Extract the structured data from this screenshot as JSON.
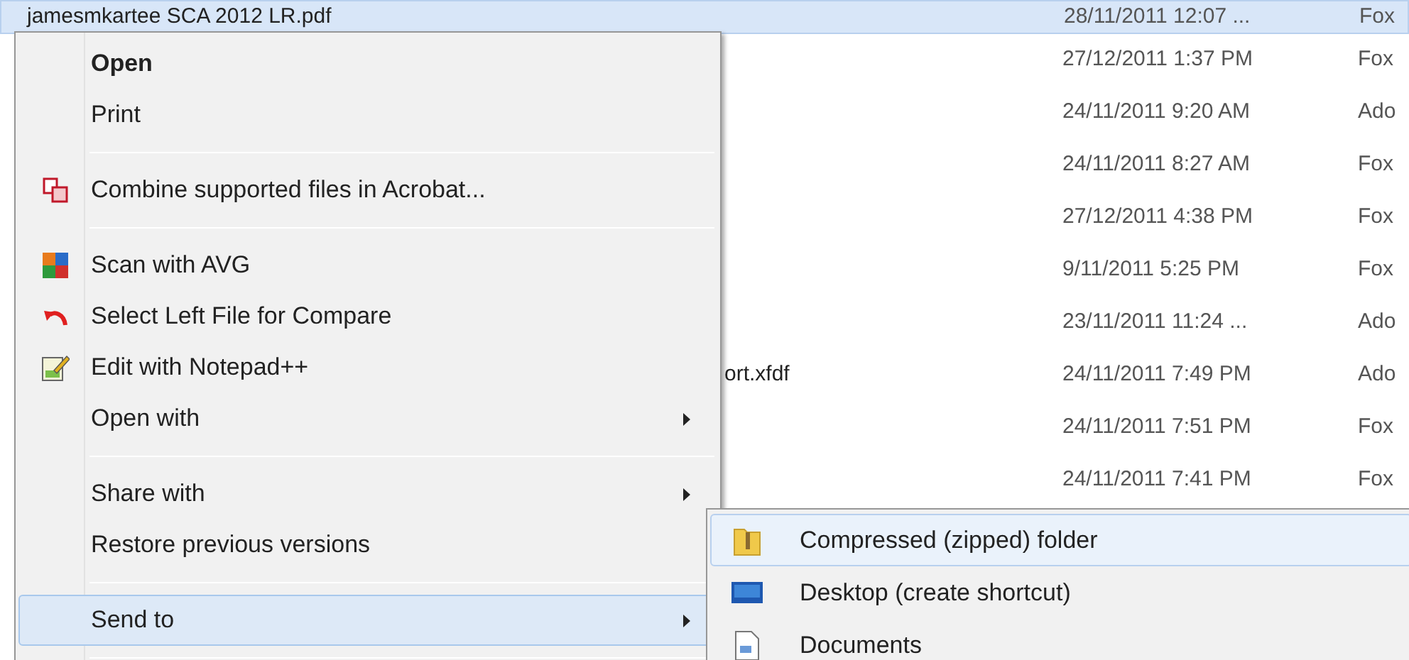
{
  "file_list": {
    "rows": [
      {
        "name": "jamesmkartee SCA 2012 LR.pdf",
        "name_cut": false,
        "date": "28/11/2011 12:07 ...",
        "type": "Fox",
        "selected": true
      },
      {
        "date": "27/12/2011 1:37 PM",
        "type": "Fox",
        "selected": false
      },
      {
        "date": "24/11/2011 9:20 AM",
        "type": "Ado",
        "selected": false
      },
      {
        "date": "24/11/2011 8:27 AM",
        "type": "Fox",
        "selected": false
      },
      {
        "date": "27/12/2011 4:38 PM",
        "type": "Fox",
        "selected": false
      },
      {
        "date": "9/11/2011 5:25 PM",
        "type": "Fox",
        "selected": false
      },
      {
        "date": "23/11/2011 11:24 ...",
        "type": "Ado",
        "selected": false
      },
      {
        "name": "ort.xfdf",
        "name_cut": true,
        "date": "24/11/2011 7:49 PM",
        "type": "Ado",
        "selected": false
      },
      {
        "date": "24/11/2011 7:51 PM",
        "type": "Fox",
        "selected": false
      },
      {
        "date": "24/11/2011 7:41 PM",
        "type": "Fox",
        "selected": false
      }
    ]
  },
  "context_menu": {
    "items": [
      {
        "kind": "item",
        "label": "Open",
        "default": true,
        "has_submenu": false,
        "selected": false
      },
      {
        "kind": "item",
        "label": "Print",
        "default": false,
        "has_submenu": false,
        "selected": false
      },
      {
        "kind": "separator"
      },
      {
        "kind": "item",
        "label": "Combine supported files in Acrobat...",
        "default": false,
        "has_submenu": false,
        "selected": false
      },
      {
        "kind": "separator"
      },
      {
        "kind": "item",
        "label": "Scan with AVG",
        "default": false,
        "has_submenu": false,
        "selected": false
      },
      {
        "kind": "item",
        "label": "Select Left File for Compare",
        "default": false,
        "has_submenu": false,
        "selected": false
      },
      {
        "kind": "item",
        "label": "Edit with Notepad++",
        "default": false,
        "has_submenu": false,
        "selected": false
      },
      {
        "kind": "item",
        "label": "Open with",
        "default": false,
        "has_submenu": true,
        "selected": false
      },
      {
        "kind": "separator"
      },
      {
        "kind": "item",
        "label": "Share with",
        "default": false,
        "has_submenu": true,
        "selected": false
      },
      {
        "kind": "item",
        "label": "Restore previous versions",
        "default": false,
        "has_submenu": false,
        "selected": false
      },
      {
        "kind": "separator"
      },
      {
        "kind": "item",
        "label": "Send to",
        "default": false,
        "has_submenu": true,
        "selected": true
      },
      {
        "kind": "separator"
      }
    ]
  },
  "send_to_menu": {
    "items": [
      {
        "label": "Compressed (zipped) folder",
        "selected": true
      },
      {
        "label": "Desktop (create shortcut)",
        "selected": false
      },
      {
        "label": "Documents",
        "selected": false
      }
    ]
  }
}
